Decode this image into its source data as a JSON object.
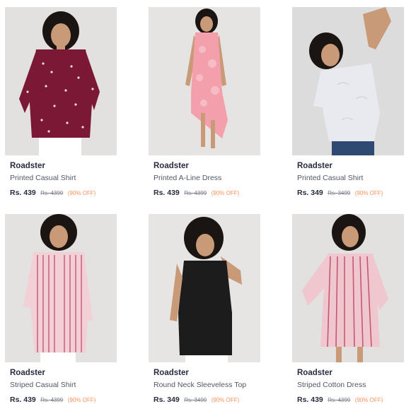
{
  "products": [
    {
      "brand": "Roadster",
      "title": "Printed Casual Shirt",
      "price": "Rs. 439",
      "mrp": "Rs. 4399",
      "discount": "(90% OFF)",
      "garment_color": "#7a1836"
    },
    {
      "brand": "Roadster",
      "title": "Printed A-Line Dress",
      "price": "Rs. 439",
      "mrp": "Rs. 4399",
      "discount": "(90% OFF)",
      "garment_color": "#f4a0ac"
    },
    {
      "brand": "Roadster",
      "title": "Printed Casual Shirt",
      "price": "Rs. 349",
      "mrp": "Rs. 3499",
      "discount": "(90% OFF)",
      "garment_color": "#e8eaf0"
    },
    {
      "brand": "Roadster",
      "title": "Striped Casual Shirt",
      "price": "Rs. 439",
      "mrp": "Rs. 4399",
      "discount": "(90% OFF)",
      "garment_color": "#f3cfd6"
    },
    {
      "brand": "Roadster",
      "title": "Round Neck Sleeveless Top",
      "price": "Rs. 349",
      "mrp": "Rs. 3499",
      "discount": "(90% OFF)",
      "garment_color": "#1c1c1c"
    },
    {
      "brand": "Roadster",
      "title": "Striped Cotton Dress",
      "price": "Rs. 439",
      "mrp": "Rs. 4399",
      "discount": "(90% OFF)",
      "garment_color": "#f0c6cf"
    }
  ]
}
